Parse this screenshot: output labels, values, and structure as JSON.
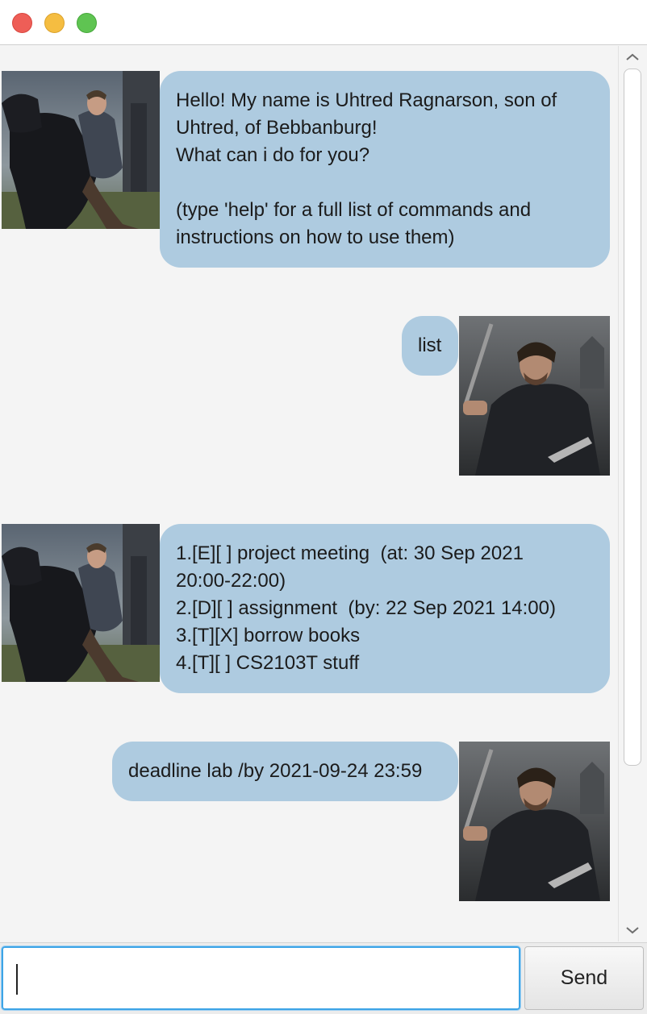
{
  "window": {
    "controls": [
      "close",
      "minimize",
      "zoom"
    ]
  },
  "messages": [
    {
      "sender": "duke",
      "avatar_icon": "warrior-on-horse-avatar",
      "text": "Hello! My name is Uhtred Ragnarson, son of\nUhtred, of Bebbanburg!\nWhat can i do for you?\n\n(type 'help' for a full list of commands and\ninstructions on how to use them)"
    },
    {
      "sender": "user",
      "avatar_icon": "warrior-with-sword-avatar",
      "text": "list"
    },
    {
      "sender": "duke",
      "avatar_icon": "warrior-on-horse-avatar",
      "text": "1.[E][ ] project meeting  (at: 30 Sep 2021\n20:00-22:00)\n2.[D][ ] assignment  (by: 22 Sep 2021 14:00)\n3.[T][X] borrow books\n4.[T][ ] CS2103T stuff"
    },
    {
      "sender": "user",
      "avatar_icon": "warrior-with-sword-avatar",
      "text": "deadline lab /by 2021-09-24 23:59"
    }
  ],
  "input": {
    "value": "",
    "placeholder": ""
  },
  "send_button": {
    "label": "Send"
  },
  "scrollbar": {
    "up_icon": "▲",
    "down_icon": "▼",
    "visible_fraction": 0.82
  },
  "colors": {
    "bubble": "#aecbe0",
    "background": "#f4f4f4",
    "focus_ring": "#3da4e6"
  }
}
